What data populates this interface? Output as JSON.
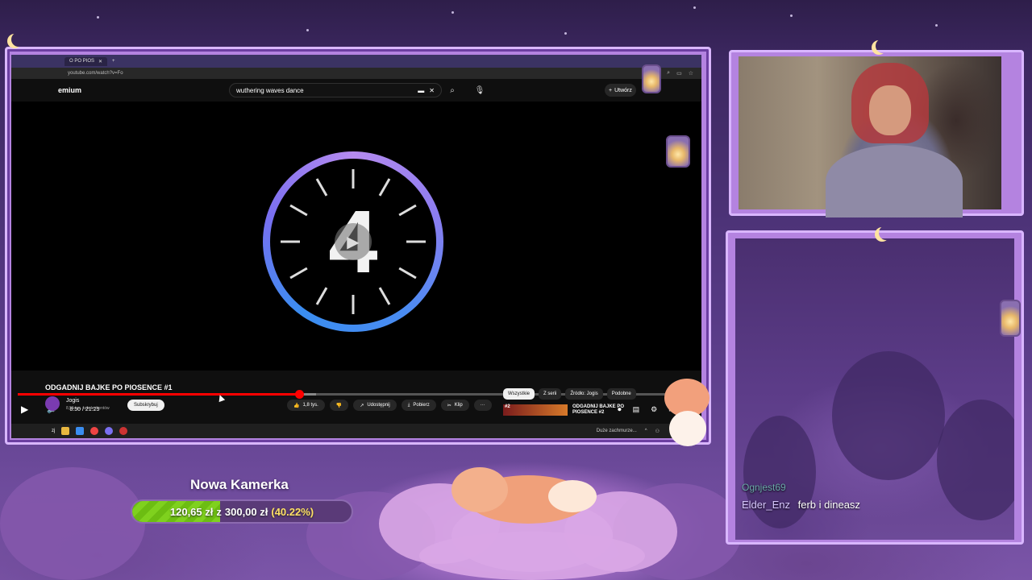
{
  "browser": {
    "tab_title": "O PO PIOS",
    "url": "youtube.com/watch?v=Fo",
    "brand": "emium",
    "search_query": "wuthering waves dance",
    "create_label": "Utwórz"
  },
  "player": {
    "countdown_number": "4",
    "time_display": "8:50 / 21:25",
    "progress_played": 0.415,
    "progress_buffered": 0.44
  },
  "video": {
    "title": "ODGADNIJ BAJKE PO PIOSENCE #1",
    "channel_name": "Jogis",
    "channel_subs": "8,51 tys. subskrybentów",
    "subscribe_label": "Subskrybuj",
    "actions": [
      {
        "icon": "thumb-up-icon",
        "label": "1,8 tys."
      },
      {
        "icon": "thumb-down-icon",
        "label": ""
      },
      {
        "icon": "share-icon",
        "label": "Udostępnij"
      },
      {
        "icon": "download-icon",
        "label": "Pobierz"
      },
      {
        "icon": "scissors-icon",
        "label": "Klip"
      },
      {
        "icon": "more-icon",
        "label": "···"
      }
    ],
    "chips": [
      "Wszystkie",
      "Z serii",
      "Źródło: Jogis",
      "Podobne"
    ],
    "recommended": {
      "badge": "#2",
      "title": "ODGADNIJ BAJKE PO PIOSENCE #2"
    }
  },
  "taskbar": {
    "left_text": "zj",
    "weather": "Duże zachmurze..."
  },
  "chat": {
    "prev_user": "Ognjest69",
    "user": "Elder_Enz",
    "message": "ferb i dineasz"
  },
  "goal": {
    "title": "Nowa Kamerka",
    "current": "120,65 zł",
    "separator": "z",
    "target": "300,00 zł",
    "percent_label": "(40.22%)",
    "fraction": 0.4022
  },
  "colors": {
    "accent_purple": "#b483e0",
    "youtube_red": "#ff0000",
    "goal_green": "#7fd11e"
  }
}
